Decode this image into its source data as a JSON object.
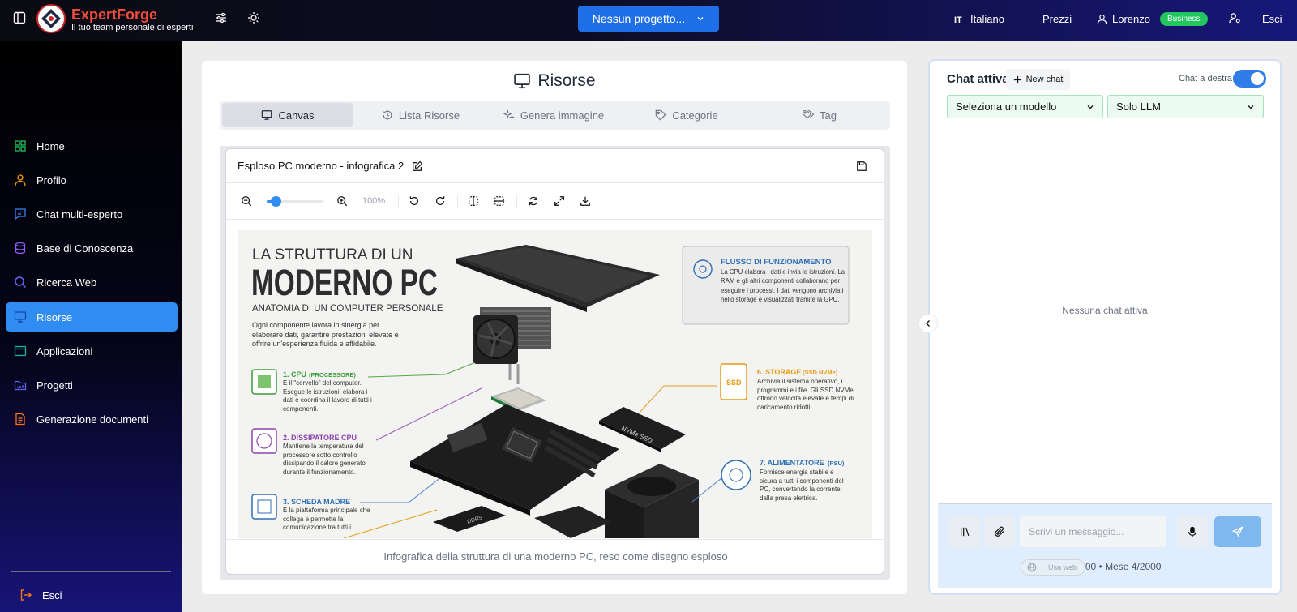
{
  "header": {
    "brand": "ExpertForge",
    "tagline": "Il tuo team personale di esperti",
    "project_button": "Nessun progetto...",
    "language": "Italiano",
    "prices": "Prezzi",
    "user_name": "Lorenzo",
    "plan_badge": "Business",
    "logout": "Esci"
  },
  "sidebar": {
    "items": [
      {
        "label": "Home",
        "icon": "home-icon"
      },
      {
        "label": "Profilo",
        "icon": "user-icon"
      },
      {
        "label": "Chat multi-esperto",
        "icon": "chat-icon"
      },
      {
        "label": "Base di Conoscenza",
        "icon": "database-icon"
      },
      {
        "label": "Ricerca Web",
        "icon": "search-icon"
      },
      {
        "label": "Risorse",
        "icon": "monitor-icon",
        "active": true
      },
      {
        "label": "Applicazioni",
        "icon": "app-window-icon"
      },
      {
        "label": "Progetti",
        "icon": "folder-icon"
      },
      {
        "label": "Generazione documenti",
        "icon": "document-icon"
      }
    ],
    "logout": "Esci"
  },
  "main": {
    "title": "Risorse",
    "tabs": [
      {
        "label": "Canvas",
        "active": true
      },
      {
        "label": "Lista Risorse"
      },
      {
        "label": "Genera immagine"
      },
      {
        "label": "Categorie"
      },
      {
        "label": "Tag"
      }
    ],
    "canvas": {
      "title": "Esploso PC moderno - infografica 2",
      "zoom": "100%",
      "zoom_level": 0.15,
      "caption": "Infografica della struttura di una moderno PC, reso come disegno esploso",
      "infographic": {
        "heading_small": "LA STRUTTURA DI UN",
        "heading_big": "MODERNO PC",
        "subtitle": "ANATOMIA DI UN COMPUTER PERSONALE",
        "intro": "Ogni componente lavora in sinergia per elaborare dati, garantire prestazioni elevate e offrire un'esperienza fluida e affidabile.",
        "flow_title": "FLUSSO DI FUNZIONAMENTO",
        "flow_text": "La CPU elabora i dati e invia le istruzioni. La RAM e gli altri componenti collaborano per eseguire i processi. I dati vengono archiviati nello storage e visualizzati tramite la GPU.",
        "ssd_label": "NVMe SSD",
        "ram_label": "DDR5",
        "ssd_icon_label": "SSD",
        "items": [
          {
            "title": "1. CPU",
            "tag": "(PROCESSORE)",
            "text": "È il \"cervello\" del computer. Esegue le istruzioni, elabora i dati e coordina il lavoro di tutti i componenti.",
            "color": "#3f9b3a"
          },
          {
            "title": "2. DISSIPATORE CPU",
            "tag": "",
            "text": "Mantiene la temperatura del processore sotto controllo dissipando il calore generato durante il funzionamento.",
            "color": "#8e44ad"
          },
          {
            "title": "3. SCHEDA MADRE",
            "tag": "",
            "text": "È la piattaforma principale che collega e permette la comunicazione tra tutti i",
            "color": "#2f6fb3"
          },
          {
            "title": "6. STORAGE",
            "tag": "(SSD NVMe)",
            "text": "Archivia il sistema operativo, i programmi e i file. Gli SSD NVMe offrono velocità elevate e tempi di caricamento ridotti.",
            "color": "#e69b12"
          },
          {
            "title": "7. ALIMENTATORE",
            "tag": "(PSU)",
            "text": "Fornisce energia stabile e sicura a tutti i componenti del PC, convertendo la corrente dalla presa elettrica.",
            "color": "#2f6fb3"
          }
        ]
      }
    }
  },
  "chat": {
    "title": "Chat attiva",
    "new_chat": "New chat",
    "toggle_label": "Chat a destra",
    "toggle_on": true,
    "model_select": "Seleziona un modello",
    "mode_select": "Solo LLM",
    "empty": "Nessuna chat attiva",
    "input_placeholder": "Scrivi un messaggio...",
    "usage": "Oggi 4/200 • Mese 4/2000",
    "web_chip": "Usa web"
  },
  "colors": {
    "accent": "#2f8cf0",
    "brand_red": "#ef4d3c",
    "badge_green": "#22c55e",
    "select_green_bg": "#ecfbf1"
  }
}
